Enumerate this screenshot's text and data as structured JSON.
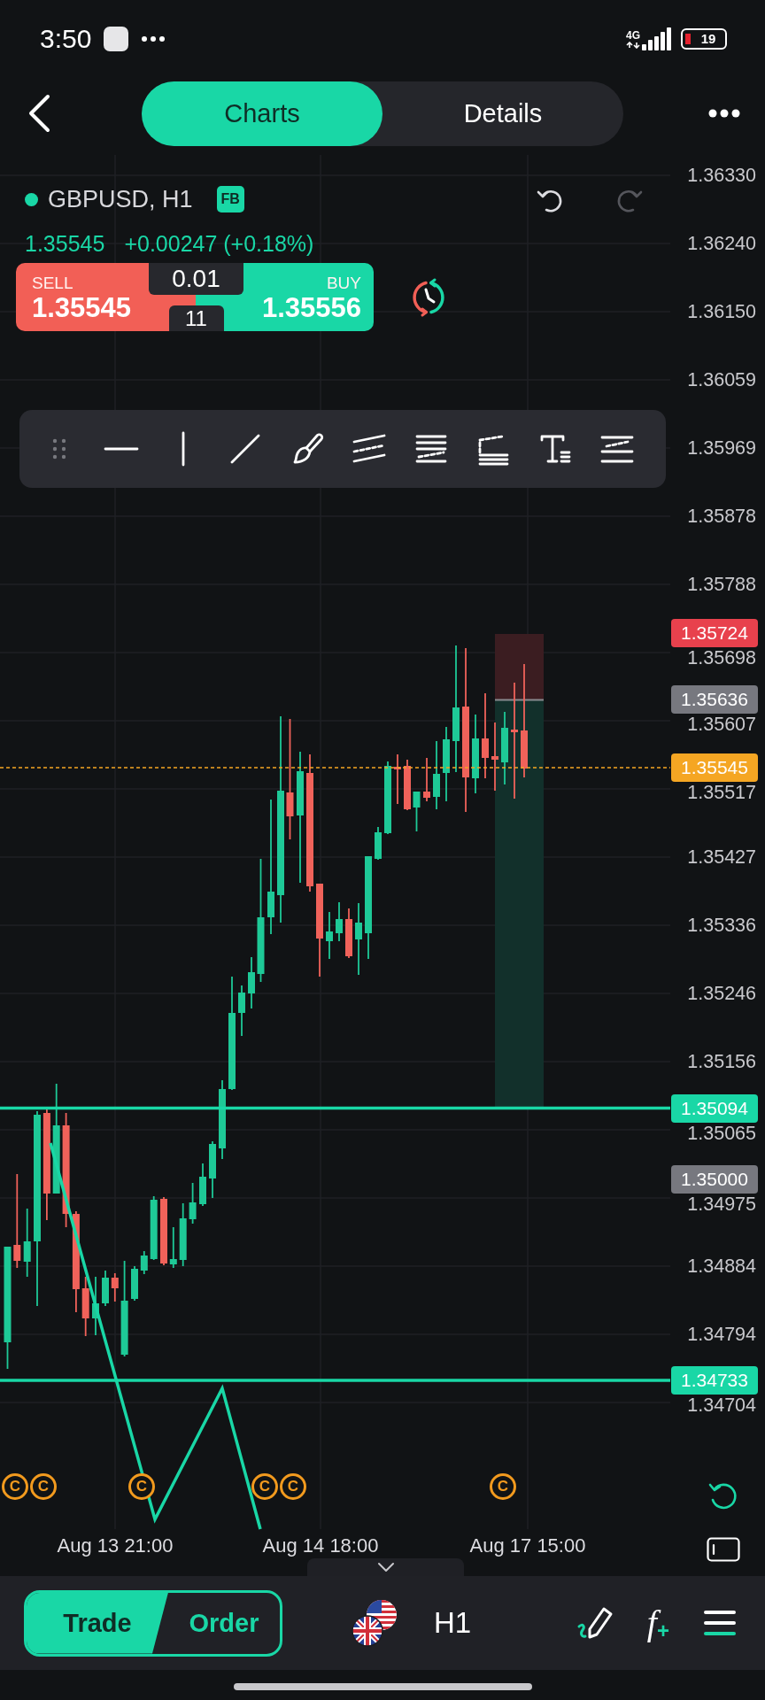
{
  "status_bar": {
    "time": "3:50",
    "network": "4G",
    "battery": "19"
  },
  "header": {
    "tabs": [
      {
        "label": "Charts",
        "selected": true
      },
      {
        "label": "Details",
        "selected": false
      }
    ]
  },
  "instrument": {
    "symbol": "GBPUSD, H1",
    "badge": "FB",
    "last_price": "1.35545",
    "change": "+0.00247 (+0.18%)",
    "undo": {
      "disabled": false
    },
    "redo": {
      "disabled": true
    }
  },
  "trade_panel": {
    "sell": {
      "label": "SELL",
      "price": "1.35545"
    },
    "lot": "0.01",
    "spread": "11",
    "buy": {
      "label": "BUY",
      "price": "1.35556"
    }
  },
  "chart": {
    "price_axis": [
      "1.36330",
      "1.36240",
      "1.36150",
      "1.36059",
      "1.35969",
      "1.35878",
      "1.35788",
      "1.35698",
      "1.35607",
      "1.35517",
      "1.35427",
      "1.35336",
      "1.35246",
      "1.35156",
      "1.35065",
      "1.34975",
      "1.34884",
      "1.34794",
      "1.34704"
    ],
    "price_tags": [
      {
        "label": "1.35724",
        "color": "#e8414d"
      },
      {
        "label": "1.35636",
        "color": "#77787f"
      },
      {
        "label": "1.35545",
        "color": "#f5a623"
      },
      {
        "label": "1.35094",
        "color": "#19d7a6"
      },
      {
        "label": "1.35000",
        "color": "#77787f"
      },
      {
        "label": "1.34733",
        "color": "#19d7a6"
      }
    ],
    "time_axis": [
      "Aug 13 21:00",
      "Aug 14 18:00",
      "Aug 17 15:00"
    ],
    "event_markers": [
      {
        "label": "C"
      },
      {
        "label": "C"
      },
      {
        "label": "C"
      },
      {
        "label": "C"
      },
      {
        "label": "C"
      },
      {
        "label": "C"
      }
    ]
  },
  "bottom_bar": {
    "modes": [
      {
        "label": "Trade",
        "selected": true
      },
      {
        "label": "Order",
        "selected": false
      }
    ],
    "timeframe": "H1",
    "indicators": {
      "symbol": "f",
      "badge": "+"
    }
  }
}
